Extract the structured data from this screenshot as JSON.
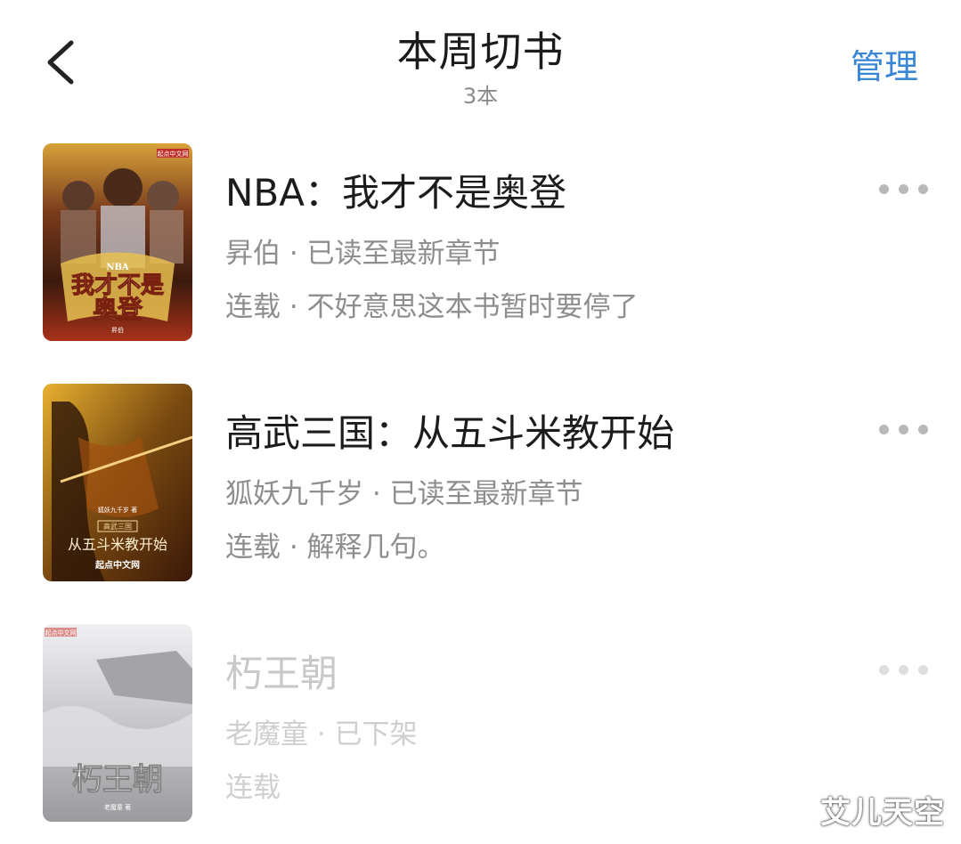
{
  "header": {
    "title": "本周切书",
    "count": "3本",
    "manage_label": "管理"
  },
  "books": [
    {
      "title": "NBA：我才不是奥登",
      "author_line": "昇伯 · 已读至最新章节",
      "status_line": "连载 · 不好意思这本书暂时要停了",
      "cover_text": {
        "brand": "起点中文网",
        "tag": "NBA",
        "main": "我才不是",
        "main2": "奥登",
        "author": "昇伯"
      }
    },
    {
      "title": "高武三国：从五斗米教开始",
      "author_line": "狐妖九千岁 · 已读至最新章节",
      "status_line": "连载 · 解释几句。",
      "cover_text": {
        "author": "狐妖九千岁 著",
        "tag": "高武三国",
        "main": "从五斗米教开始",
        "brand": "起点中文网"
      }
    },
    {
      "title": "朽王朝",
      "author_line": "老魔童 · 已下架",
      "status_line": "连载",
      "cover_text": {
        "brand": "起点中文网",
        "main": "朽王朝",
        "author": "老魔童 著"
      }
    }
  ],
  "watermark": "艾儿天空",
  "colors": {
    "accent": "#3a86d6",
    "title": "#1c1c1c",
    "meta": "#8e8e8e",
    "faded": "#c8c8c8"
  }
}
